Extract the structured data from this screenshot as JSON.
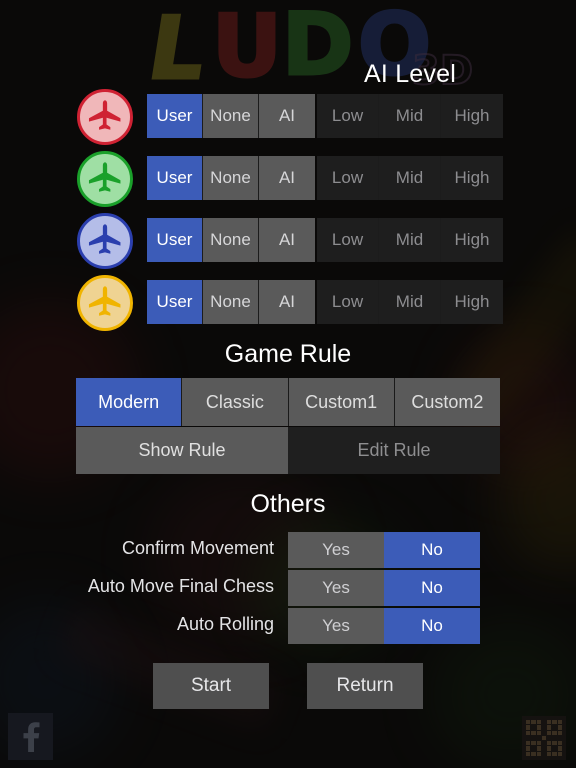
{
  "app": {
    "logo_text": "LUDO",
    "logo_suffix": "3D",
    "logo_letters": [
      "L",
      "U",
      "D",
      "O"
    ]
  },
  "ai_level": {
    "heading": "AI Level"
  },
  "players": [
    {
      "avatar_icon": "airplane-icon",
      "color_name": "red",
      "color": "#cf2233",
      "fill": "#f0b7b9",
      "mode_options": [
        "User",
        "None",
        "AI"
      ],
      "mode_selected": "User",
      "level_options": [
        "Low",
        "Mid",
        "High"
      ],
      "level_selected": ""
    },
    {
      "avatar_icon": "airplane-icon",
      "color_name": "green",
      "color": "#1aa02a",
      "fill": "#9fdfa4",
      "mode_options": [
        "User",
        "None",
        "AI"
      ],
      "mode_selected": "User",
      "level_options": [
        "Low",
        "Mid",
        "High"
      ],
      "level_selected": ""
    },
    {
      "avatar_icon": "airplane-icon",
      "color_name": "blue",
      "color": "#2b3fae",
      "fill": "#b4bde8",
      "mode_options": [
        "User",
        "None",
        "AI"
      ],
      "mode_selected": "User",
      "level_options": [
        "Low",
        "Mid",
        "High"
      ],
      "level_selected": ""
    },
    {
      "avatar_icon": "airplane-icon",
      "color_name": "yellow",
      "color": "#f0b400",
      "fill": "#efd392",
      "mode_options": [
        "User",
        "None",
        "AI"
      ],
      "mode_selected": "User",
      "level_options": [
        "Low",
        "Mid",
        "High"
      ],
      "level_selected": ""
    }
  ],
  "game_rule": {
    "heading": "Game Rule",
    "tabs": [
      "Modern",
      "Classic",
      "Custom1",
      "Custom2"
    ],
    "selected_tab": "Modern",
    "show_rule_label": "Show Rule",
    "edit_rule_label": "Edit Rule",
    "edit_rule_enabled": false
  },
  "others": {
    "heading": "Others",
    "rows": [
      {
        "label": "Confirm Movement",
        "options": [
          "Yes",
          "No"
        ],
        "selected": "No"
      },
      {
        "label": "Auto Move Final Chess",
        "options": [
          "Yes",
          "No"
        ],
        "selected": "No"
      },
      {
        "label": "Auto Rolling",
        "options": [
          "Yes",
          "No"
        ],
        "selected": "No"
      }
    ]
  },
  "bottom": {
    "start_label": "Start",
    "return_label": "Return"
  },
  "corner": {
    "facebook_icon": "facebook-icon",
    "qr_icon": "qr-code-icon"
  },
  "colors": {
    "accent_blue": "#3c5cb8",
    "button_gray": "#5a5a5a",
    "disabled_dark": "#1e1e1e",
    "background": "#0a0908",
    "text": "#e8e8ea"
  }
}
